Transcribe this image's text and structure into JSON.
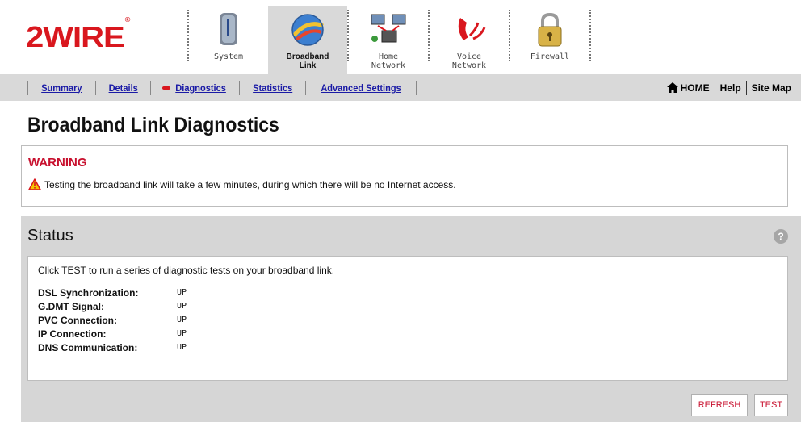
{
  "logo": {
    "text": "2WIRE",
    "mark": "®"
  },
  "tabs": [
    {
      "label": "System",
      "icon": "system-icon",
      "active": false
    },
    {
      "label": "Broadband\nLink",
      "icon": "broadband-link-icon",
      "active": true
    },
    {
      "label": "Home\nNetwork",
      "icon": "home-network-icon",
      "active": false
    },
    {
      "label": "Voice\nNetwork",
      "icon": "voice-network-icon",
      "active": false
    },
    {
      "label": "Firewall",
      "icon": "firewall-icon",
      "active": false
    }
  ],
  "subnav": {
    "summary": "Summary",
    "details": "Details",
    "diagnostics": "Diagnostics",
    "statistics": "Statistics",
    "advanced": "Advanced Settings",
    "home": "HOME",
    "help": "Help",
    "sitemap": "Site Map"
  },
  "page_title": "Broadband Link Diagnostics",
  "warning": {
    "title": "WARNING",
    "message": "Testing the broadband link will take a few minutes, during which there will be no Internet access."
  },
  "status": {
    "title": "Status",
    "help_label": "?",
    "intro": "Click TEST to run a series of diagnostic tests on your broadband link.",
    "rows": [
      {
        "label": "DSL Synchronization:",
        "value": "UP"
      },
      {
        "label": "G.DMT Signal:",
        "value": "UP"
      },
      {
        "label": "PVC Connection:",
        "value": "UP"
      },
      {
        "label": "IP Connection:",
        "value": "UP"
      },
      {
        "label": "DNS Communication:",
        "value": "UP"
      }
    ],
    "refresh_label": "REFRESH",
    "test_label": "TEST"
  },
  "colors": {
    "brand": "#d9171e",
    "link": "#1a1aa6",
    "panel": "#d6d6d6",
    "warning": "#c8102e"
  }
}
